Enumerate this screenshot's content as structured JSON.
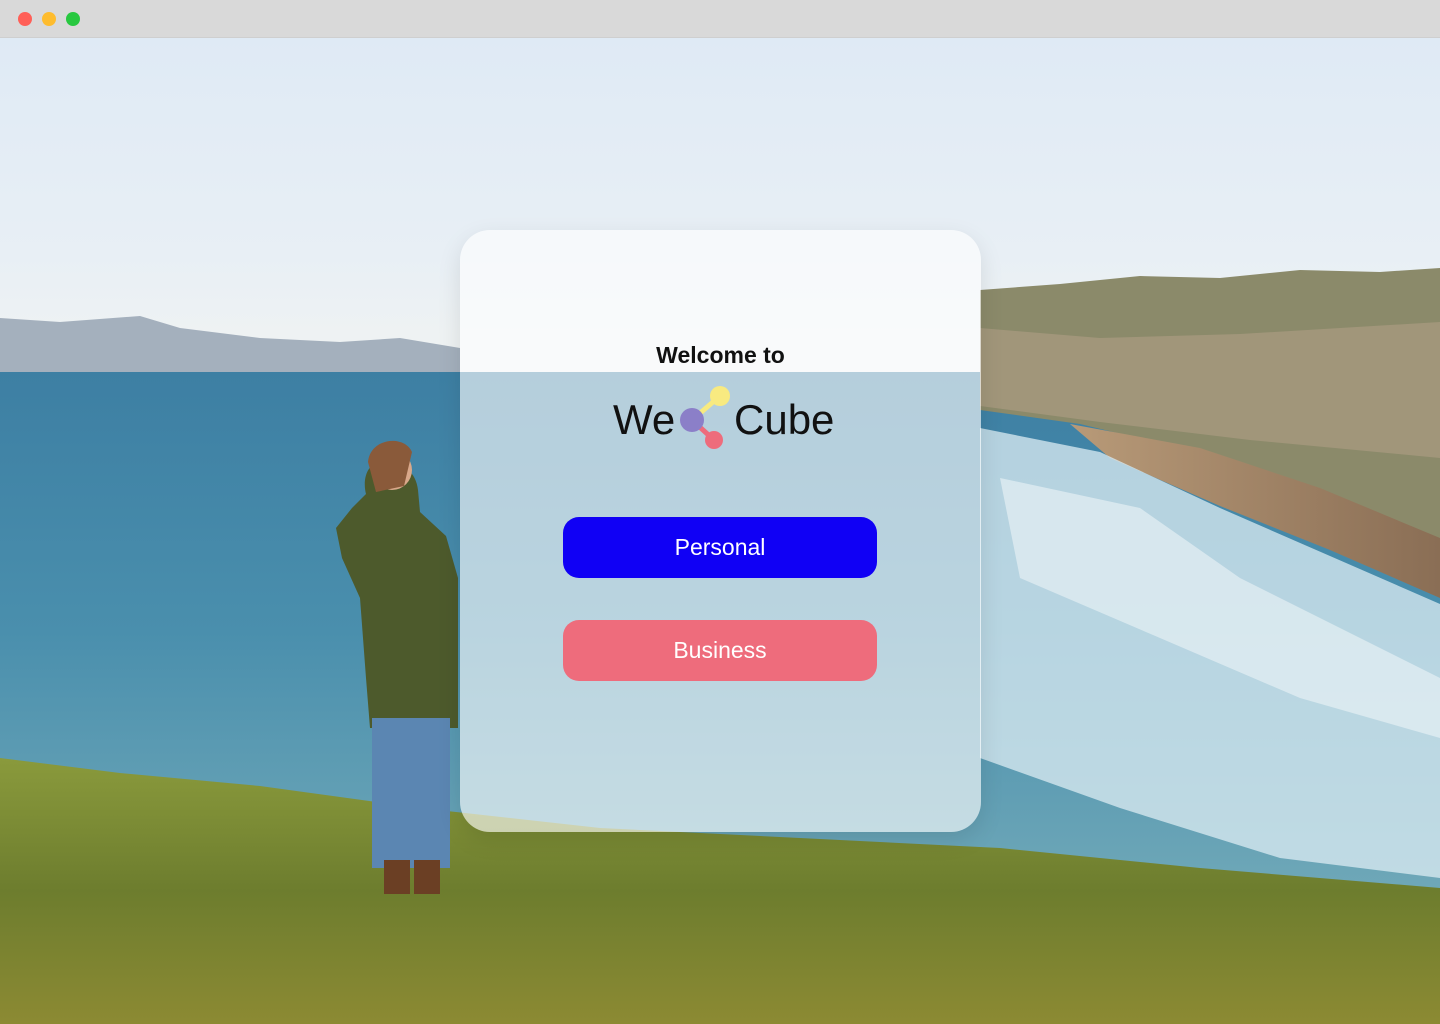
{
  "window": {
    "controls": [
      "close-button",
      "minimize-button",
      "maximize-button"
    ]
  },
  "card": {
    "welcome_text": "Welcome to",
    "logo": {
      "left_text": "We",
      "right_text": "Cube",
      "mark_colors": [
        "#8b7fc8",
        "#f8ea80",
        "#ee6c7c"
      ]
    },
    "buttons": {
      "personal_label": "Personal",
      "business_label": "Business"
    }
  },
  "colors": {
    "personal_button": "#1000f5",
    "business_button": "#ee6c7c"
  }
}
